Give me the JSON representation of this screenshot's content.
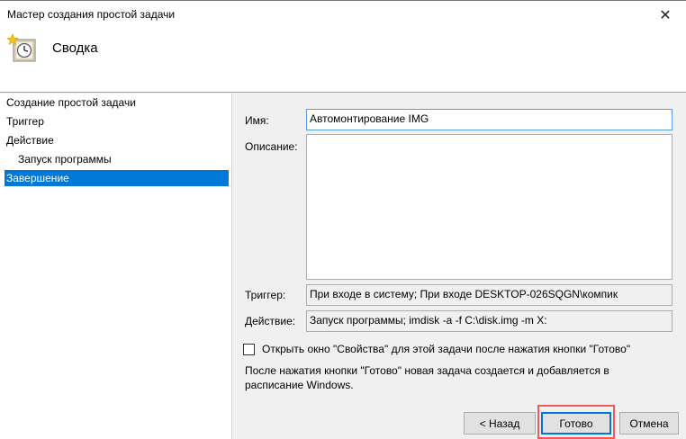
{
  "window": {
    "title": "Мастер создания простой задачи"
  },
  "header": {
    "heading": "Сводка",
    "icon": "scheduled-task-clock-icon"
  },
  "nav": {
    "items": [
      {
        "label": "Создание простой задачи",
        "selected": false
      },
      {
        "label": "Триггер",
        "selected": false
      },
      {
        "label": "Действие",
        "selected": false
      },
      {
        "label": "Запуск программы",
        "selected": false
      },
      {
        "label": "Завершение",
        "selected": true
      }
    ]
  },
  "form": {
    "name_label": "Имя:",
    "name_value": "Автомонтирование IMG",
    "description_label": "Описание:",
    "description_value": "",
    "trigger_label": "Триггер:",
    "trigger_value": "При входе в систему; При входе DESKTOP-026SQGN\\компик",
    "action_label": "Действие:",
    "action_value": "Запуск программы; imdisk -a -f C:\\disk.img -m X:"
  },
  "options": {
    "open_properties_label": "Открыть окно \"Свойства\" для этой задачи после нажатия кнопки \"Готово\"",
    "open_properties_checked": false,
    "info_text": "После нажатия кнопки \"Готово\" новая задача создается и добавляется в расписание Windows."
  },
  "buttons": {
    "back": "< Назад",
    "finish": "Готово",
    "cancel": "Отмена"
  }
}
